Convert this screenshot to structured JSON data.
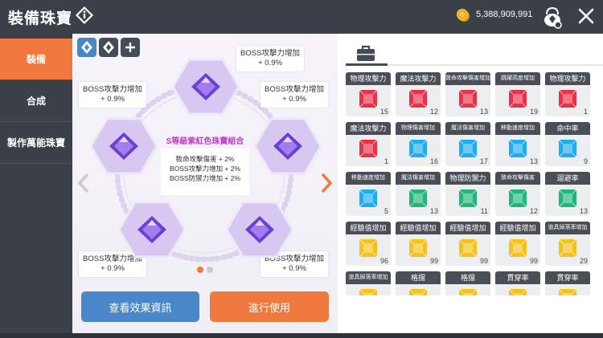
{
  "header": {
    "title": "裝備珠寶",
    "currency": "5,388,909,991",
    "info_icon": "info-icon",
    "coin_icon": "coin-icon",
    "bag_icon": "jewel-bag-icon",
    "close_icon": "close-icon"
  },
  "sidebar": {
    "items": [
      {
        "label": "裝備",
        "active": true
      },
      {
        "label": "合成",
        "active": false
      },
      {
        "label": "製作萬能珠寶",
        "active": false
      }
    ]
  },
  "slots": [
    {
      "icon": "jewel-slot-icon-1",
      "selected": true
    },
    {
      "icon": "jewel-slot-icon-2",
      "selected": false
    },
    {
      "icon": "add-icon",
      "selected": false
    }
  ],
  "set": {
    "name": "S等級紫紅色珠寶組合",
    "effects": [
      "致命攻擊傷害 + 2%",
      "BOSS攻擊力增加 + 2%",
      "BOSS防禦力增加 + 2%"
    ]
  },
  "jewels": [
    {
      "name": "BOSS攻擊力增加",
      "value": "+ 0.9%"
    },
    {
      "name": "BOSS攻擊力增加",
      "value": "+ 0.9%"
    },
    {
      "name": "BOSS攻擊力增加",
      "value": "+ 0.9%"
    },
    {
      "name": "BOSS攻擊力增加",
      "value": "+ 0.9%"
    },
    {
      "name": "BOSS攻擊力增加",
      "value": "+ 0.9%"
    }
  ],
  "page_dots": [
    {
      "active": true
    },
    {
      "active": false
    }
  ],
  "buttons": {
    "view_effects": "查看效果資訊",
    "apply": "進行使用"
  },
  "inventory": {
    "tab_icon": "briefcase-icon",
    "items": [
      {
        "name": "物理攻擊力",
        "count": "15",
        "color": "#e8324a"
      },
      {
        "name": "魔法攻擊力",
        "count": "12",
        "color": "#e8324a"
      },
      {
        "name": "致命攻擊傷害增加",
        "count": "13",
        "color": "#e8324a"
      },
      {
        "name": "跳躍高度增加",
        "count": "19",
        "color": "#e8324a"
      },
      {
        "name": "物理攻擊力",
        "count": "1",
        "color": "#e8324a"
      },
      {
        "name": "魔法攻擊力",
        "count": "1",
        "color": "#e8324a"
      },
      {
        "name": "物理傷害增加",
        "count": "16",
        "color": "#1eaef0"
      },
      {
        "name": "魔法傷害增加",
        "count": "17",
        "color": "#1eaef0"
      },
      {
        "name": "移動速度增加",
        "count": "13",
        "color": "#1eaef0"
      },
      {
        "name": "命中率",
        "count": "9",
        "color": "#1eaef0"
      },
      {
        "name": "移動速度增加",
        "count": "5",
        "color": "#1eaef0"
      },
      {
        "name": "魔法傷害增加",
        "count": "13",
        "color": "#22b67a"
      },
      {
        "name": "物理防禦力",
        "count": "11",
        "color": "#22b67a"
      },
      {
        "name": "致命攻擊傷害",
        "count": "12",
        "color": "#22b67a"
      },
      {
        "name": "迴避率",
        "count": "13",
        "color": "#22b67a"
      },
      {
        "name": "經驗值增加",
        "count": "96",
        "color": "#f5c21b"
      },
      {
        "name": "經驗值增加",
        "count": "99",
        "color": "#f5c21b"
      },
      {
        "name": "經驗值增加",
        "count": "99",
        "color": "#f5c21b"
      },
      {
        "name": "經驗值增加",
        "count": "99",
        "color": "#f5c21b"
      },
      {
        "name": "道具掉落率增加",
        "count": "29",
        "color": "#f5c21b"
      },
      {
        "name": "道具掉落率增加",
        "count": "",
        "color": "#f5c21b"
      },
      {
        "name": "格擋",
        "count": "",
        "color": "#f5c21b"
      },
      {
        "name": "格擋",
        "count": "",
        "color": "#f5c21b"
      },
      {
        "name": "貫穿率",
        "count": "",
        "color": "#f5c21b"
      },
      {
        "name": "貫穿率",
        "count": "",
        "color": "#f5c21b"
      }
    ]
  }
}
